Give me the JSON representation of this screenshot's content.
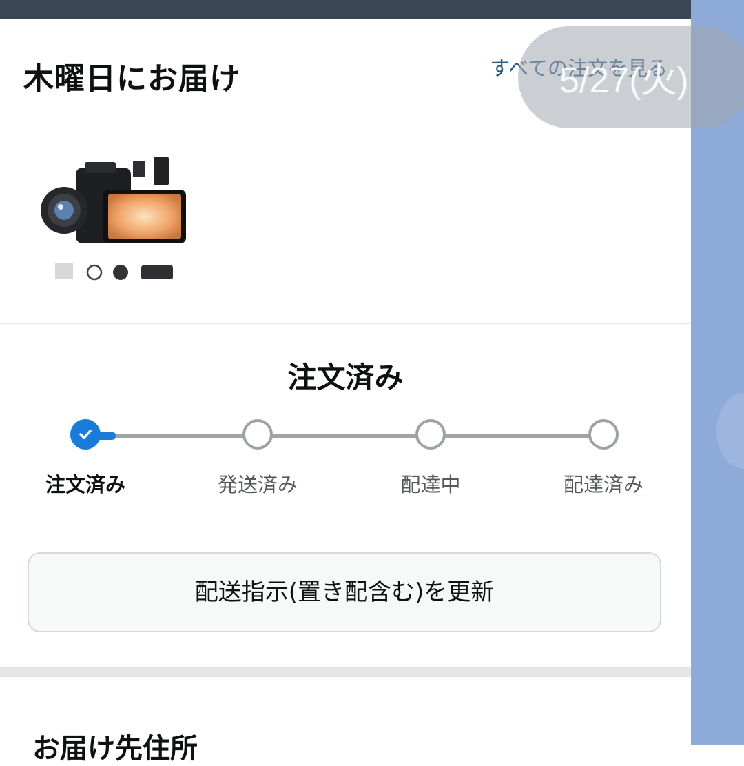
{
  "header": {
    "title": "木曜日にお届け",
    "view_all_link": "すべての注文を見る"
  },
  "overlay": {
    "date": "5/27(火)"
  },
  "product": {
    "image_alt": "ビデオカメラ"
  },
  "status": {
    "title": "注文済み",
    "progress_step": 1,
    "steps": [
      {
        "label": "注文済み",
        "state": "done"
      },
      {
        "label": "発送済み",
        "state": "pending"
      },
      {
        "label": "配達中",
        "state": "pending"
      },
      {
        "label": "配達済み",
        "state": "pending"
      }
    ]
  },
  "actions": {
    "update_label": "配送指示(置き配含む)を更新"
  },
  "address": {
    "title": "お届け先住所"
  },
  "colors": {
    "accent": "#1a7bd8",
    "link": "#2c5a85",
    "topbar": "#3b4656",
    "side_panel": "#8eaad8"
  }
}
